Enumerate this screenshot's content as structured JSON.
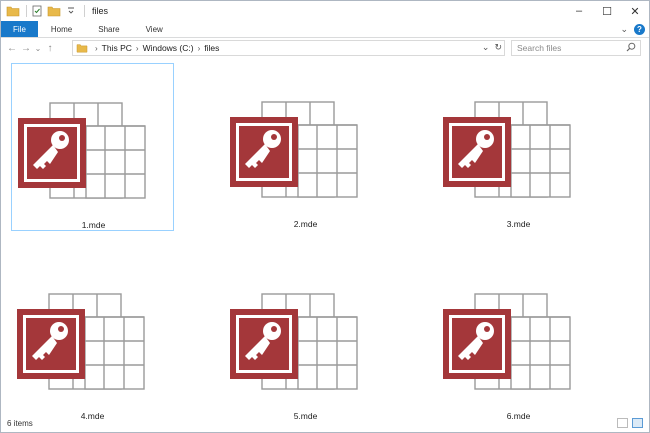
{
  "window": {
    "title": "files",
    "controls": {
      "minimize": "–",
      "maximize": "☐",
      "close": "✕"
    }
  },
  "ribbon": {
    "tabs": [
      {
        "label": "File"
      },
      {
        "label": "Home"
      },
      {
        "label": "Share"
      },
      {
        "label": "View"
      }
    ],
    "expand_glyph": "⌄",
    "help_glyph": "?"
  },
  "nav": {
    "back": "←",
    "forward": "→",
    "recent": "⌄",
    "up": "↑",
    "breadcrumb": [
      "This PC",
      "Windows (C:)",
      "files"
    ],
    "crumb_separator": "›",
    "dropdown": "⌄",
    "refresh": "↻"
  },
  "search": {
    "placeholder": "Search files",
    "icon": "search-icon"
  },
  "files": [
    {
      "name": "1.mde",
      "selected": true
    },
    {
      "name": "2.mde",
      "selected": false
    },
    {
      "name": "3.mde",
      "selected": false
    },
    {
      "name": "4.mde",
      "selected": false
    },
    {
      "name": "5.mde",
      "selected": false
    },
    {
      "name": "6.mde",
      "selected": false
    }
  ],
  "status": {
    "item_count": "6 items"
  },
  "colors": {
    "access_red": "#a4373a",
    "grid_gray": "#9a9a9a",
    "accent_blue": "#1979ca",
    "selection_border": "#99d1ff"
  }
}
